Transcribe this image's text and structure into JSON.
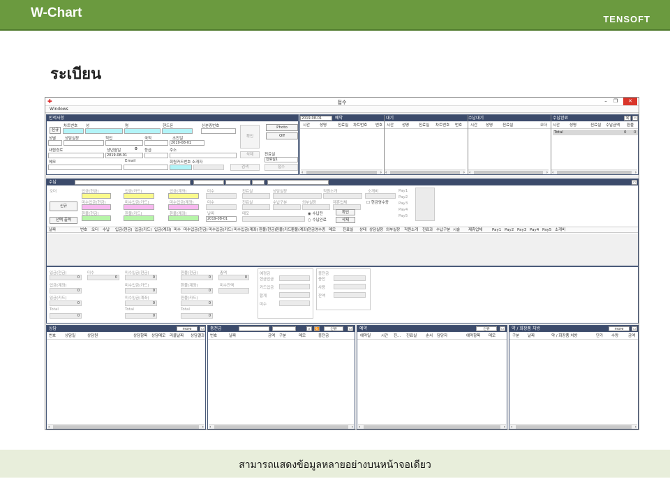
{
  "header": {
    "title": "W-Chart",
    "brand": "TENSOFT"
  },
  "section_title": "ระเบียน",
  "caption": "สามารถแสดงข้อมูลหลายอย่างบนหน้าจอเดียว",
  "colors": {
    "topbar": "#6b9a3f",
    "caption_bg": "#e8eedb",
    "panel_header": "#3c4b6b",
    "field_cyan": "#b3f4f8",
    "field_yellow": "#fafa8c",
    "field_pink": "#f7b8ef",
    "field_green": "#b6f5a8",
    "close_button": "#d9352a"
  },
  "window": {
    "title": "접수",
    "menu": "Windows",
    "patient": {
      "header": "인적사항",
      "new_btn": "신규",
      "chart_no": "차트번호",
      "last": "성",
      "first": "명",
      "phone": "핸드폰",
      "id_no": "신분증번호",
      "gender": "성별",
      "counsel": "상담실장",
      "job": "직업",
      "nation": "국적",
      "first_visit": "초진일",
      "first_visit_val": "2019-08-01",
      "route": "내원경로",
      "birth": "생년월일",
      "birth_val": "2019-08-01",
      "age": "0",
      "grade": "등급",
      "address": "주소",
      "memo": "메모",
      "email": "Email",
      "member_card": "회원카드번호 소개자",
      "photo_btn": "Photo",
      "off_btn": "Off",
      "confirm_btn": "확인",
      "delete_btn": "삭제",
      "search_btn": "검색",
      "room_label": "진료실",
      "room_val": "진료실1",
      "receive_btn": "접수"
    },
    "top_panels": {
      "date": "2019-08-01",
      "reservation": {
        "title": "예약",
        "cols": [
          "시간",
          "성명",
          "진료실",
          "차트번호",
          "번호"
        ]
      },
      "waiting": {
        "title": "대기",
        "cols": [
          "시간",
          "성명",
          "진료실",
          "차트번호",
          "번호"
        ]
      },
      "payment_wait": {
        "title": "수납대기",
        "cols": [
          "시간",
          "성명",
          "진료실",
          "오더"
        ]
      },
      "payment_done": {
        "title": "수납완료",
        "btn": "복",
        "cols": [
          "시간",
          "성명",
          "진료실",
          "수납금액",
          "환불"
        ],
        "total_label": "Total",
        "total_amount": "0",
        "total_refund": "0"
      }
    },
    "payment": {
      "header": "수납",
      "order": "오더",
      "new_btn": "신규",
      "print_btn": "선택 출력",
      "in_cash": "입금(현금)",
      "unpaid_cash": "미수입금(현금)",
      "refund_cash": "환불(현금)",
      "in_card": "입금(카드)",
      "unpaid_card": "미수입금(카드)",
      "refund_card": "환불(카드)",
      "in_transfer": "입금(계좌)",
      "unpaid_transfer": "미수입금(계좌)",
      "refund_transfer": "환불(계좌)",
      "unpaid": "미수",
      "date": "날짜",
      "date_val": "2019-08-01",
      "memo": "메모",
      "room": "진료실",
      "counsel": "상담실장",
      "referral": "직원소개",
      "product": "소개비",
      "pay_type": "수납구분",
      "outside": "외부실장",
      "partner": "제휴업체",
      "receipt": "현금영수증",
      "pay_done": "수납전",
      "pay_complete": "수납완료",
      "confirm_btn": "확인",
      "delete_btn": "삭제",
      "pays": [
        "Pay1",
        "Pay2",
        "Pay3",
        "Pay4",
        "Pay5"
      ],
      "grid_cols": [
        "날짜",
        "번호",
        "오더",
        "수납",
        "입금(현금)",
        "입금(카드)",
        "입금(계좌)",
        "미수",
        "미수입금(현금)",
        "미수입금(카드)",
        "미수입금(계좌)",
        "환불(현금)",
        "환불(카드)",
        "환불(계좌)",
        "현금영수증",
        "메모",
        "진료실",
        "상태",
        "상담실장",
        "외부실장",
        "직원소개",
        "진료과",
        "수납구분",
        "시술",
        "제휴업체",
        "Pay1",
        "Pay2",
        "Pay3",
        "Pay4",
        "Pay5",
        "소개비"
      ]
    },
    "summary": {
      "in_cash": "입금(현금)",
      "in_transfer": "입금(계좌)",
      "in_card": "입금(카드)",
      "total": "Total",
      "unpaid": "미수",
      "unpaid_cash": "미수입금(현금)",
      "unpaid_card": "미수입금(카드)",
      "unpaid_transfer": "미수입금(계좌)",
      "refund_cash": "환불(현금)",
      "refund_transfer": "환불(계좌)",
      "refund_card": "환불(카드)",
      "total_amount": "총액",
      "unpaid_balance": "미수잔액",
      "expected": "예정금",
      "cash_in": "현금입금",
      "card_in": "카드입금",
      "sum": "합계",
      "unpaid2": "미수",
      "deposit": "충전금",
      "charge": "충전",
      "use": "사용",
      "balance": "잔액",
      "zero": "0"
    },
    "bottom_panels": {
      "consult": {
        "title": "상담",
        "more_btn": "more",
        "cols": [
          "번호",
          "상담일",
          "상담원",
          "상담항목",
          "상담메모",
          "리콜날짜",
          "상담결과"
        ]
      },
      "deposit": {
        "title": "충전금",
        "new_btn": "신규",
        "cols": [
          "번호",
          "날짜",
          "금액",
          "구분",
          "메모",
          "충전금"
        ]
      },
      "reservation": {
        "title": "예약",
        "new_btn": "신규",
        "cols": [
          "예약일",
          "시간",
          "진...",
          "진료실",
          "순서",
          "담당자",
          "예약항목",
          "메모"
        ]
      },
      "prescription": {
        "title": "약 / 화장품 처방",
        "more_btn": "more",
        "cols": [
          "구분",
          "날짜",
          "약 / 화장품 처방",
          "단가",
          "수량",
          "금액"
        ]
      }
    }
  }
}
